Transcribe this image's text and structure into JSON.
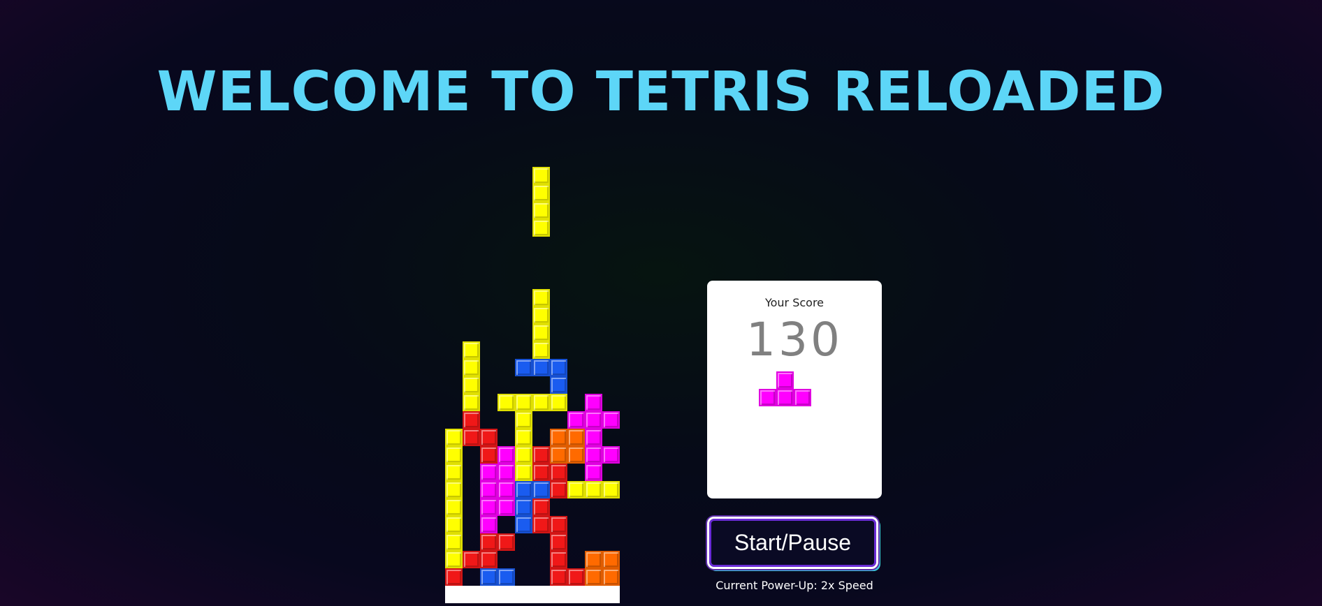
{
  "title": "WELCOME TO TETRIS RELOADED",
  "colors": {
    "title": "#5dd6f7",
    "yellow": "#ffff00",
    "red": "#f01818",
    "magenta": "#ff00ff",
    "blue": "#1a5cf0",
    "orange": "#ff6a00"
  },
  "board": {
    "columns": 10,
    "rows": 25,
    "cells": [
      {
        "col": 5,
        "row": 0,
        "color": "yellow"
      },
      {
        "col": 5,
        "row": 1,
        "color": "yellow"
      },
      {
        "col": 5,
        "row": 2,
        "color": "yellow"
      },
      {
        "col": 5,
        "row": 3,
        "color": "yellow"
      },
      {
        "col": 5,
        "row": 7,
        "color": "yellow"
      },
      {
        "col": 5,
        "row": 8,
        "color": "yellow"
      },
      {
        "col": 5,
        "row": 9,
        "color": "yellow"
      },
      {
        "col": 5,
        "row": 10,
        "color": "yellow"
      },
      {
        "col": 1,
        "row": 10,
        "color": "yellow"
      },
      {
        "col": 1,
        "row": 11,
        "color": "yellow"
      },
      {
        "col": 1,
        "row": 12,
        "color": "yellow"
      },
      {
        "col": 1,
        "row": 13,
        "color": "yellow"
      },
      {
        "col": 4,
        "row": 11,
        "color": "blue"
      },
      {
        "col": 5,
        "row": 11,
        "color": "blue"
      },
      {
        "col": 6,
        "row": 11,
        "color": "blue"
      },
      {
        "col": 6,
        "row": 12,
        "color": "blue"
      },
      {
        "col": 3,
        "row": 13,
        "color": "yellow"
      },
      {
        "col": 4,
        "row": 13,
        "color": "yellow"
      },
      {
        "col": 5,
        "row": 13,
        "color": "yellow"
      },
      {
        "col": 6,
        "row": 13,
        "color": "yellow"
      },
      {
        "col": 4,
        "row": 14,
        "color": "yellow"
      },
      {
        "col": 4,
        "row": 15,
        "color": "yellow"
      },
      {
        "col": 4,
        "row": 16,
        "color": "yellow"
      },
      {
        "col": 4,
        "row": 17,
        "color": "yellow"
      },
      {
        "col": 8,
        "row": 13,
        "color": "magenta"
      },
      {
        "col": 7,
        "row": 14,
        "color": "magenta"
      },
      {
        "col": 8,
        "row": 14,
        "color": "magenta"
      },
      {
        "col": 9,
        "row": 14,
        "color": "magenta"
      },
      {
        "col": 1,
        "row": 14,
        "color": "red"
      },
      {
        "col": 1,
        "row": 15,
        "color": "red"
      },
      {
        "col": 2,
        "row": 15,
        "color": "red"
      },
      {
        "col": 2,
        "row": 16,
        "color": "red"
      },
      {
        "col": 6,
        "row": 15,
        "color": "orange"
      },
      {
        "col": 7,
        "row": 15,
        "color": "orange"
      },
      {
        "col": 6,
        "row": 16,
        "color": "orange"
      },
      {
        "col": 7,
        "row": 16,
        "color": "orange"
      },
      {
        "col": 8,
        "row": 15,
        "color": "magenta"
      },
      {
        "col": 8,
        "row": 16,
        "color": "magenta"
      },
      {
        "col": 9,
        "row": 16,
        "color": "magenta"
      },
      {
        "col": 8,
        "row": 17,
        "color": "magenta"
      },
      {
        "col": 3,
        "row": 16,
        "color": "magenta"
      },
      {
        "col": 2,
        "row": 17,
        "color": "magenta"
      },
      {
        "col": 3,
        "row": 17,
        "color": "magenta"
      },
      {
        "col": 2,
        "row": 18,
        "color": "magenta"
      },
      {
        "col": 3,
        "row": 18,
        "color": "magenta"
      },
      {
        "col": 2,
        "row": 19,
        "color": "magenta"
      },
      {
        "col": 3,
        "row": 19,
        "color": "magenta"
      },
      {
        "col": 2,
        "row": 20,
        "color": "magenta"
      },
      {
        "col": 5,
        "row": 16,
        "color": "red"
      },
      {
        "col": 5,
        "row": 17,
        "color": "red"
      },
      {
        "col": 6,
        "row": 17,
        "color": "red"
      },
      {
        "col": 6,
        "row": 18,
        "color": "red"
      },
      {
        "col": 0,
        "row": 15,
        "color": "yellow"
      },
      {
        "col": 0,
        "row": 16,
        "color": "yellow"
      },
      {
        "col": 0,
        "row": 17,
        "color": "yellow"
      },
      {
        "col": 0,
        "row": 18,
        "color": "yellow"
      },
      {
        "col": 0,
        "row": 19,
        "color": "yellow"
      },
      {
        "col": 0,
        "row": 20,
        "color": "yellow"
      },
      {
        "col": 0,
        "row": 21,
        "color": "yellow"
      },
      {
        "col": 0,
        "row": 22,
        "color": "yellow"
      },
      {
        "col": 4,
        "row": 18,
        "color": "blue"
      },
      {
        "col": 5,
        "row": 18,
        "color": "blue"
      },
      {
        "col": 4,
        "row": 19,
        "color": "blue"
      },
      {
        "col": 7,
        "row": 18,
        "color": "yellow"
      },
      {
        "col": 8,
        "row": 18,
        "color": "yellow"
      },
      {
        "col": 9,
        "row": 18,
        "color": "yellow"
      },
      {
        "col": 5,
        "row": 19,
        "color": "red"
      },
      {
        "col": 5,
        "row": 20,
        "color": "red"
      },
      {
        "col": 6,
        "row": 20,
        "color": "red"
      },
      {
        "col": 6,
        "row": 21,
        "color": "red"
      },
      {
        "col": 6,
        "row": 22,
        "color": "red"
      },
      {
        "col": 6,
        "row": 23,
        "color": "red"
      },
      {
        "col": 4,
        "row": 20,
        "color": "blue"
      },
      {
        "col": 2,
        "row": 21,
        "color": "red"
      },
      {
        "col": 3,
        "row": 21,
        "color": "red"
      },
      {
        "col": 1,
        "row": 22,
        "color": "red"
      },
      {
        "col": 2,
        "row": 22,
        "color": "red"
      },
      {
        "col": 0,
        "row": 23,
        "color": "red"
      },
      {
        "col": 2,
        "row": 23,
        "color": "blue"
      },
      {
        "col": 3,
        "row": 23,
        "color": "blue"
      },
      {
        "col": 7,
        "row": 23,
        "color": "red"
      },
      {
        "col": 8,
        "row": 22,
        "color": "orange"
      },
      {
        "col": 9,
        "row": 22,
        "color": "orange"
      },
      {
        "col": 8,
        "row": 23,
        "color": "orange"
      },
      {
        "col": 9,
        "row": 23,
        "color": "orange"
      }
    ]
  },
  "score_panel": {
    "label": "Your Score",
    "value": "130",
    "next_piece": {
      "shape": "T",
      "color": "magenta",
      "cells": [
        {
          "col": 1,
          "row": 0
        },
        {
          "col": 0,
          "row": 1
        },
        {
          "col": 1,
          "row": 1
        },
        {
          "col": 2,
          "row": 1
        }
      ]
    }
  },
  "start_button_label": "Start/Pause",
  "powerup_text": "Current Power-Up: 2x Speed"
}
